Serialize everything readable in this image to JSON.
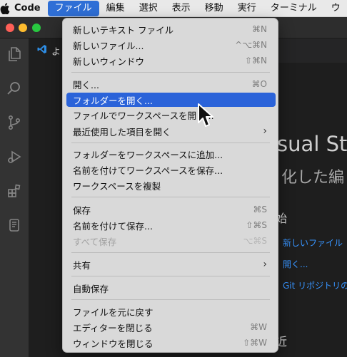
{
  "menubar": {
    "app_name": "Code",
    "items": [
      "ファイル",
      "編集",
      "選択",
      "表示",
      "移動",
      "実行",
      "ターミナル",
      "ウ"
    ]
  },
  "activity_icons": [
    "explorer-icon",
    "search-icon",
    "source-control-icon",
    "run-debug-icon",
    "extensions-icon",
    "remote-explorer-icon"
  ],
  "tab": {
    "label": "よ"
  },
  "welcome": {
    "title": "isual St",
    "subtitle": "化した編",
    "start_heading": "始",
    "links": [
      "新しいファイル",
      "開く...",
      "Git リポジトリの"
    ],
    "recent_heading": "近"
  },
  "file_menu": {
    "items": [
      {
        "label": "新しいテキスト ファイル",
        "shortcut": "⌘N"
      },
      {
        "label": "新しいファイル...",
        "shortcut": "^⌥⌘N"
      },
      {
        "label": "新しいウィンドウ",
        "shortcut": "⇧⌘N"
      },
      {
        "label": "開く...",
        "shortcut": "⌘O"
      },
      {
        "label": "フォルダーを開く...",
        "shortcut": ""
      },
      {
        "label": "ファイルでワークスペースを開く...",
        "shortcut": ""
      },
      {
        "label": "最近使用した項目を開く",
        "shortcut": ""
      },
      {
        "label": "フォルダーをワークスペースに追加...",
        "shortcut": ""
      },
      {
        "label": "名前を付けてワークスペースを保存...",
        "shortcut": ""
      },
      {
        "label": "ワークスペースを複製",
        "shortcut": ""
      },
      {
        "label": "保存",
        "shortcut": "⌘S"
      },
      {
        "label": "名前を付けて保存...",
        "shortcut": "⇧⌘S"
      },
      {
        "label": "すべて保存",
        "shortcut": "⌥⌘S"
      },
      {
        "label": "共有",
        "shortcut": ""
      },
      {
        "label": "自動保存",
        "shortcut": ""
      },
      {
        "label": "ファイルを元に戻す",
        "shortcut": ""
      },
      {
        "label": "エディターを閉じる",
        "shortcut": "⌘W"
      },
      {
        "label": "ウィンドウを閉じる",
        "shortcut": "⇧⌘W"
      }
    ]
  },
  "colors": {
    "selection": "#2b63d9",
    "link": "#3794ff",
    "menubar_active": "#2f6fd6"
  }
}
